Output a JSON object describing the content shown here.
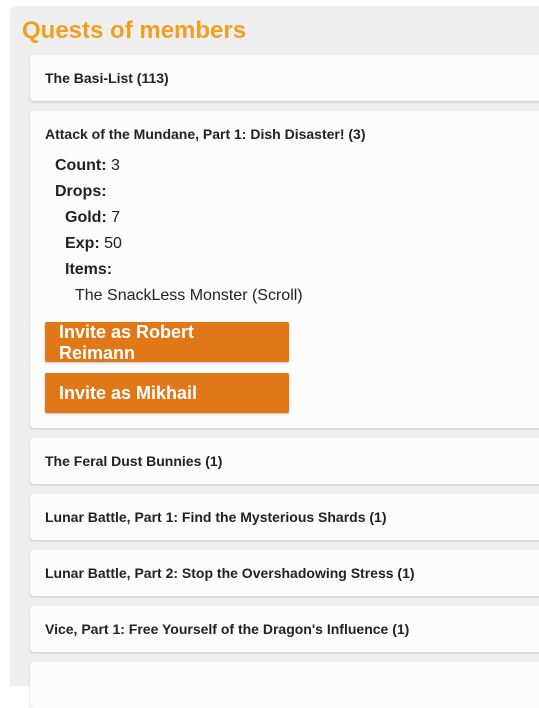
{
  "section": {
    "title": "Quests of members"
  },
  "quests": [
    {
      "label": "The Basi-List (113)"
    },
    {
      "label": "Attack of the Mundane, Part 1: Dish Disaster! (3)",
      "details": {
        "count_label": "Count:",
        "count_value": "3",
        "drops_label": "Drops:",
        "gold_label": "Gold:",
        "gold_value": "7",
        "exp_label": "Exp:",
        "exp_value": "50",
        "items_label": "Items:",
        "items": [
          "The SnackLess Monster (Scroll)"
        ]
      },
      "buttons": [
        "Invite as Robert Reimann",
        "Invite as Mikhail"
      ]
    },
    {
      "label": "The Feral Dust Bunnies (1)"
    },
    {
      "label": "Lunar Battle, Part 1: Find the Mysterious Shards (1)"
    },
    {
      "label": "Lunar Battle, Part 2: Stop the Overshadowing Stress (1)"
    },
    {
      "label": "Vice, Part 1: Free Yourself of the Dragon's Influence (1)"
    }
  ],
  "colors": {
    "accent_title": "#f0a020",
    "button_bg": "#e07818",
    "panel_bg": "#efefef",
    "card_bg": "#fcfcfc"
  }
}
